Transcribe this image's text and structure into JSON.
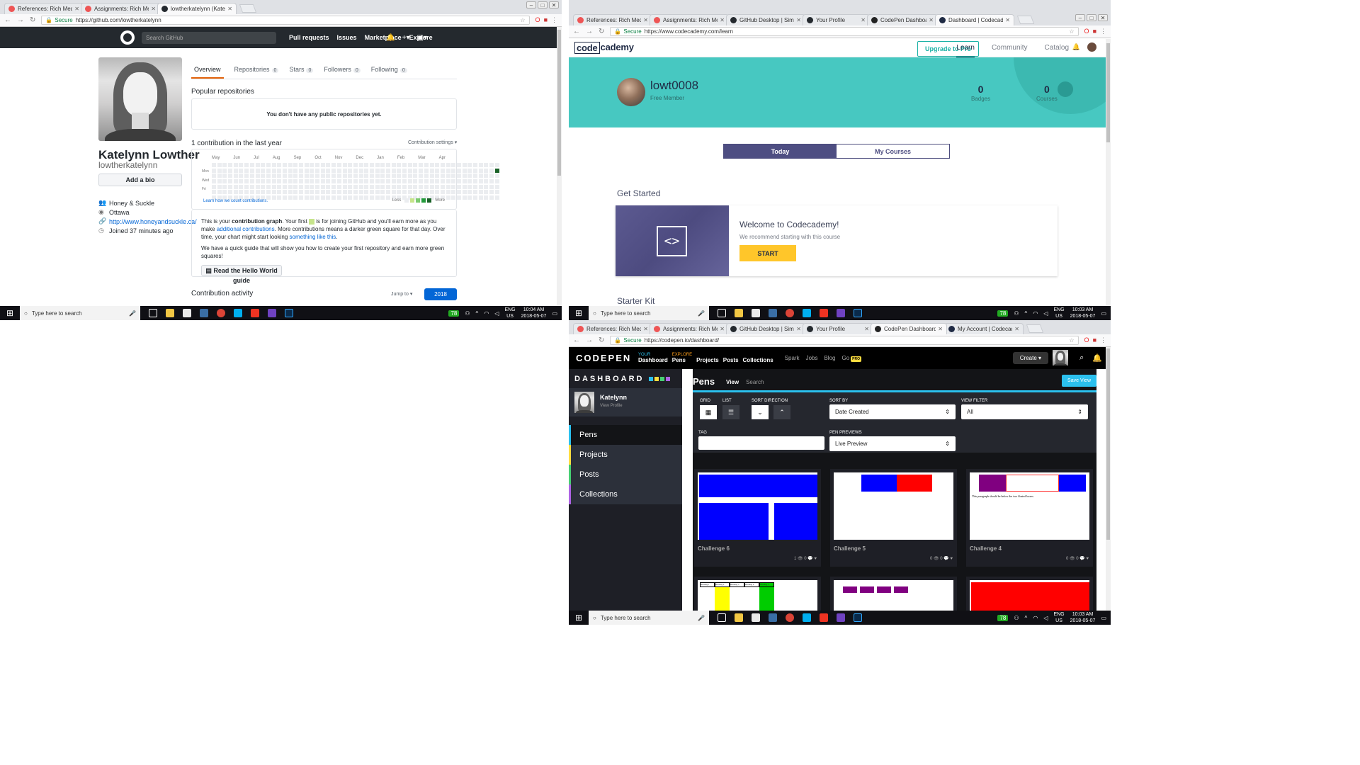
{
  "windows": {
    "github": {
      "tabs": [
        {
          "label": "References: Rich Media S",
          "fav": "#e55"
        },
        {
          "label": "Assignments: Rich Media",
          "fav": "#e55"
        },
        {
          "label": "lowtherkatelynn (Katelyn",
          "fav": "#24292e"
        }
      ],
      "omni": {
        "secure": "Secure",
        "url": "https://github.com/lowtherkatelynn"
      },
      "header": {
        "search_placeholder": "Search GitHub",
        "nav": [
          "Pull requests",
          "Issues",
          "Marketplace",
          "Explore"
        ]
      },
      "profile": {
        "name": "Katelynn Lowther",
        "login": "lowtherkatelynn",
        "add_bio": "Add a bio",
        "company": "Honey & Suckle",
        "location": "Ottawa",
        "website": "http://www.honeyandsuckle.ca/",
        "joined": "Joined 37 minutes ago"
      },
      "tabs_nav": [
        {
          "label": "Overview",
          "count": ""
        },
        {
          "label": "Repositories",
          "count": "0"
        },
        {
          "label": "Stars",
          "count": "0"
        },
        {
          "label": "Followers",
          "count": "0"
        },
        {
          "label": "Following",
          "count": "0"
        }
      ],
      "popular_title": "Popular repositories",
      "no_repos": "You don't have any public repositories yet.",
      "contrib_title": "1 contribution in the last year",
      "contrib_settings": "Contribution settings ▾",
      "months": [
        "May",
        "Jun",
        "Jul",
        "Aug",
        "Sep",
        "Oct",
        "Nov",
        "Dec",
        "Jan",
        "Feb",
        "Mar",
        "Apr"
      ],
      "days": [
        "Mon",
        "Wed",
        "Fri"
      ],
      "learn_link": "Learn how we count contributions.",
      "less": "Less",
      "more": "More",
      "info_p1_a": "This is your ",
      "info_p1_b": "contribution graph",
      "info_p1_c": ". Your first ",
      "info_p1_d": " is for joining GitHub and you'll earn more as you make ",
      "info_p1_link1": "additional contributions",
      "info_p1_e": ". More contributions means a darker green square for that day. Over time, your chart might start looking ",
      "info_p1_link2": "something like this",
      "info_p1_f": ".",
      "info_p2": "We have a quick guide that will show you how to create your first repository and earn more green squares!",
      "guide_button": "Read the Hello World guide",
      "activity_title": "Contribution activity",
      "jump_to": "Jump to ▾",
      "year": "2018"
    },
    "codecademy": {
      "tabs": [
        {
          "label": "References: Rich Media S",
          "fav": "#e55"
        },
        {
          "label": "Assignments: Rich Media",
          "fav": "#e55"
        },
        {
          "label": "GitHub Desktop | Simple",
          "fav": "#24292e"
        },
        {
          "label": "Your Profile",
          "fav": "#24292e"
        },
        {
          "label": "CodePen Dashboard",
          "fav": "#222"
        },
        {
          "label": "Dashboard | Codecadem",
          "fav": "#1f2a44"
        }
      ],
      "omni": {
        "secure": "Secure",
        "url": "https://www.codecademy.com/learn"
      },
      "logo_code": "code",
      "logo_rest": "cademy",
      "upgrade": "Upgrade to Pro",
      "nav": [
        "Learn",
        "Community",
        "Catalog"
      ],
      "username": "lowt0008",
      "membership": "Free Member",
      "badges_value": "0",
      "badges_label": "Badges",
      "courses_value": "0",
      "courses_label": "Courses",
      "toggle": [
        "Today",
        "My Courses"
      ],
      "get_started": "Get Started",
      "welcome": "Welcome to Codecademy!",
      "recommend": "We recommend starting with this course",
      "start": "START",
      "starter_kit": "Starter Kit"
    },
    "codepen": {
      "tabs": [
        {
          "label": "References: Rich Media S",
          "fav": "#e55"
        },
        {
          "label": "Assignments: Rich Media",
          "fav": "#e55"
        },
        {
          "label": "GitHub Desktop | Simple",
          "fav": "#24292e"
        },
        {
          "label": "Your Profile",
          "fav": "#24292e"
        },
        {
          "label": "CodePen Dashboard",
          "fav": "#222"
        },
        {
          "label": "My Account | Codecadem",
          "fav": "#1f2a44"
        }
      ],
      "omni": {
        "secure": "Secure",
        "url": "https://codepen.io/dashboard/"
      },
      "logo": "CODEPEN",
      "your": "YOUR",
      "dashboard": "Dashboard",
      "explore": "EXPLORE",
      "nav_main": [
        "Pens",
        "Projects",
        "Posts",
        "Collections"
      ],
      "nav_more": [
        "Spark",
        "Jobs",
        "Blog",
        "Go"
      ],
      "pro": "PRO",
      "create": "Create ▾",
      "dash_title": "DASHBOARD",
      "user": "Katelynn",
      "view_profile": "View Profile",
      "side_items": [
        "Pens",
        "Projects",
        "Posts",
        "Collections"
      ],
      "pens_title": "Pens",
      "view": "View",
      "search": "Search",
      "save_view": "Save View",
      "lbl_grid": "GRID",
      "lbl_list": "LIST",
      "lbl_sortdir": "SORT DIRECTION",
      "lbl_sortby": "SORT BY",
      "sort_value": "Date Created",
      "lbl_viewfilter": "VIEW FILTER",
      "filter_value": "All",
      "lbl_tag": "TAG",
      "lbl_previews": "PEN PREVIEWS",
      "preview_value": "Live Preview",
      "pens": [
        {
          "title": "Challenge 6",
          "meta": "1 👁  0 💬  ♥"
        },
        {
          "title": "Challenge 5",
          "meta": "0 👁  0 💬  ♥"
        },
        {
          "title": "Challenge 4",
          "meta": "0 👁  0 💬  ♥"
        }
      ],
      "challenge4_text": "This paragraph should be below the two floated boxes.",
      "table_headers": [
        "Heading 1",
        "Heading 2",
        "Heading 3",
        "Heading 4",
        "Heading 5"
      ]
    }
  },
  "taskbar": {
    "search": "Type here to search",
    "lang": "ENG",
    "region": "US",
    "battery": "78",
    "time_left": "10:04 AM",
    "time_right": "10:03 AM",
    "date": "2018-05-07"
  }
}
